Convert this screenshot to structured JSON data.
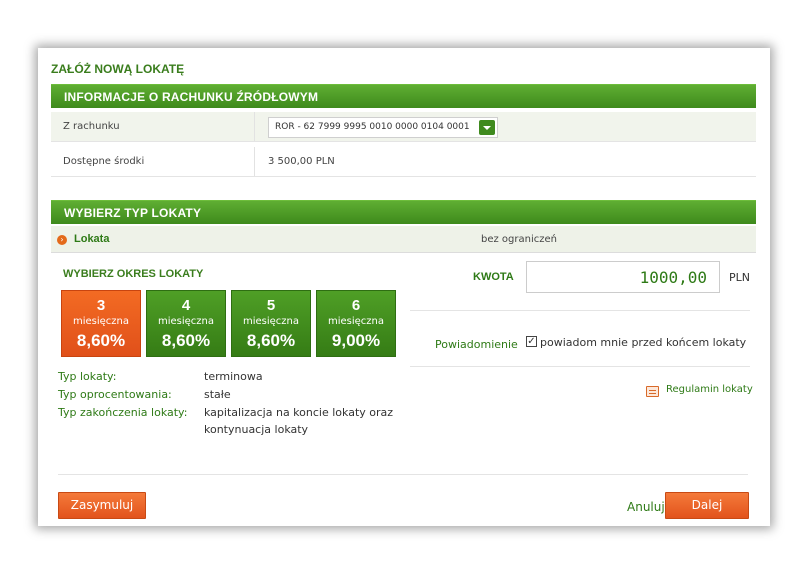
{
  "dialog": {
    "title": "ZAŁÓŻ NOWĄ LOKATĘ"
  },
  "source_account": {
    "header": "INFORMACJE O RACHUNKU ŹRÓDŁOWYM",
    "from_label": "Z rachunku",
    "from_value": "ROR - 62 7999 9995 0010 0000 0104 0001",
    "available_label": "Dostępne środki",
    "available_value": "3 500,00 PLN"
  },
  "deposit_type": {
    "header": "WYBIERZ TYP LOKATY",
    "name": "Lokata",
    "limit": "bez ograniczeń"
  },
  "period": {
    "heading": "WYBIERZ OKRES LOKATY",
    "tiles": [
      {
        "months": "3",
        "unit": "miesięczna",
        "rate": "8,60%",
        "selected": true
      },
      {
        "months": "4",
        "unit": "miesięczna",
        "rate": "8,60%",
        "selected": false
      },
      {
        "months": "5",
        "unit": "miesięczna",
        "rate": "8,60%",
        "selected": false
      },
      {
        "months": "6",
        "unit": "miesięczna",
        "rate": "9,00%",
        "selected": false
      }
    ]
  },
  "details": {
    "type_label": "Typ lokaty:",
    "type_value": "terminowa",
    "interest_label": "Typ oprocentowania:",
    "interest_value": "stałe",
    "ending_label": "Typ zakończenia lokaty:",
    "ending_value": "kapitalizacja na koncie lokaty oraz kontynuacja lokaty"
  },
  "amount": {
    "label": "KWOTA",
    "value": "1000,00",
    "currency": "PLN"
  },
  "notification": {
    "label": "Powiadomienie",
    "checkbox_text": "powiadom mnie przed końcem lokaty",
    "checked": true
  },
  "regulations": {
    "link": "Regulamin lokaty",
    "icon": "printer-icon"
  },
  "footer": {
    "simulate": "Zasymuluj",
    "cancel": "Anuluj",
    "next": "Dalej"
  },
  "colors": {
    "brand_green": "#3e8a1c",
    "accent_orange": "#e2531c"
  }
}
